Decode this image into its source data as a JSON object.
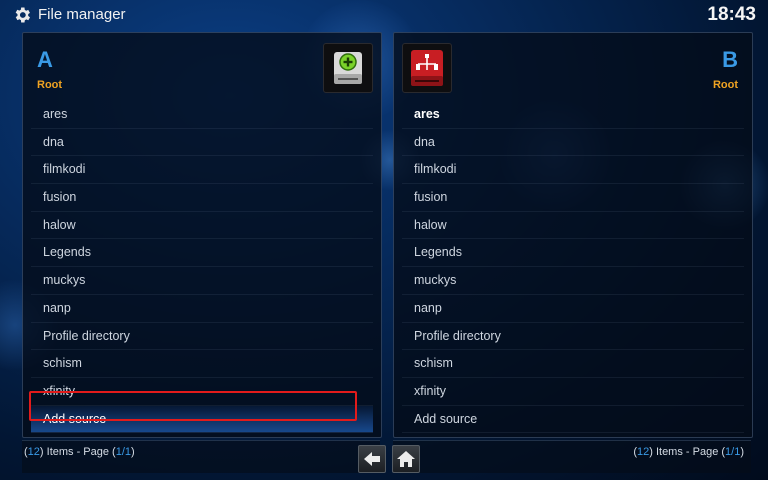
{
  "header": {
    "title": "File manager",
    "clock": "18:43"
  },
  "left_panel": {
    "letter": "A",
    "subtitle": "Root",
    "icon": "drive-add-icon",
    "items": [
      "ares",
      "dna",
      "filmkodi",
      "fusion",
      "halow",
      "Legends",
      "muckys",
      "nanp",
      "Profile directory",
      "schism",
      "xfinity",
      "Add source"
    ],
    "selected_index": 11,
    "footer": {
      "open": "(",
      "count": "12",
      "middle": ") Items - Page (",
      "page": "1/1",
      "close": ")"
    }
  },
  "right_panel": {
    "letter": "B",
    "subtitle": "Root",
    "icon": "network-drive-icon",
    "items": [
      "ares",
      "dna",
      "filmkodi",
      "fusion",
      "halow",
      "Legends",
      "muckys",
      "nanp",
      "Profile directory",
      "schism",
      "xfinity",
      "Add source"
    ],
    "footer": {
      "open": "(",
      "count": "12",
      "middle": ") Items - Page (",
      "page": "1/1",
      "close": ")"
    }
  },
  "nav": {
    "back_icon": "arrow-left-icon",
    "home_icon": "home-icon"
  },
  "colors": {
    "accent": "#3a9ae6",
    "subtitle": "#f0a322",
    "highlight": "#e21b1b"
  }
}
